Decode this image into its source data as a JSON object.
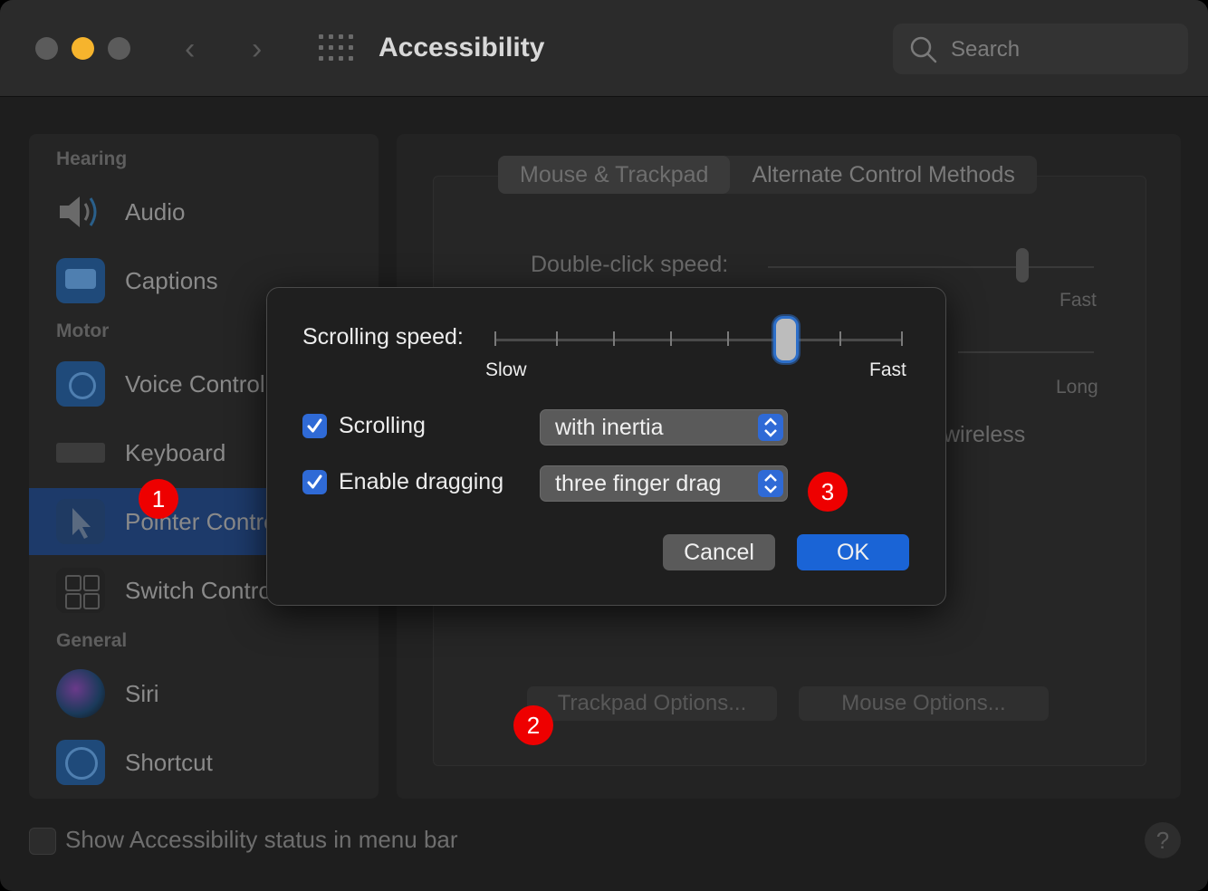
{
  "window": {
    "title": "Accessibility",
    "search_placeholder": "Search"
  },
  "sidebar": {
    "sections": [
      "Hearing",
      "Motor",
      "General"
    ],
    "items": [
      {
        "label": "Audio"
      },
      {
        "label": "Captions"
      },
      {
        "label": "Voice Control"
      },
      {
        "label": "Keyboard"
      },
      {
        "label": "Pointer Control",
        "selected": true
      },
      {
        "label": "Switch Control"
      },
      {
        "label": "Siri"
      },
      {
        "label": "Shortcut"
      }
    ]
  },
  "main": {
    "tabs": [
      {
        "label": "Mouse & Trackpad",
        "active": true
      },
      {
        "label": "Alternate Control Methods",
        "active": false
      }
    ],
    "double_click_label": "Double-click speed:",
    "fast_label": "Fast",
    "long_label": "Long",
    "wireless_fragment": "wireless",
    "trackpad_options": "Trackpad Options...",
    "mouse_options": "Mouse Options..."
  },
  "footer": {
    "status_label": "Show Accessibility status in menu bar",
    "help": "?"
  },
  "dialog": {
    "scrolling_speed_label": "Scrolling speed:",
    "slow_label": "Slow",
    "fast_label": "Fast",
    "scrolling_speed_level": 0.7,
    "scrolling_label": "Scrolling",
    "scrolling_checked": true,
    "scrolling_value": "with inertia",
    "dragging_label": "Enable dragging",
    "dragging_checked": true,
    "dragging_value": "three finger drag",
    "cancel_label": "Cancel",
    "ok_label": "OK"
  },
  "badges": [
    "1",
    "2",
    "3"
  ],
  "colors": {
    "accent": "#1a64d6",
    "badge": "#e00000",
    "close_light": "#5b5b5b",
    "minimize_light": "#f6b42d",
    "zoom_light": "#5b5b5b"
  }
}
